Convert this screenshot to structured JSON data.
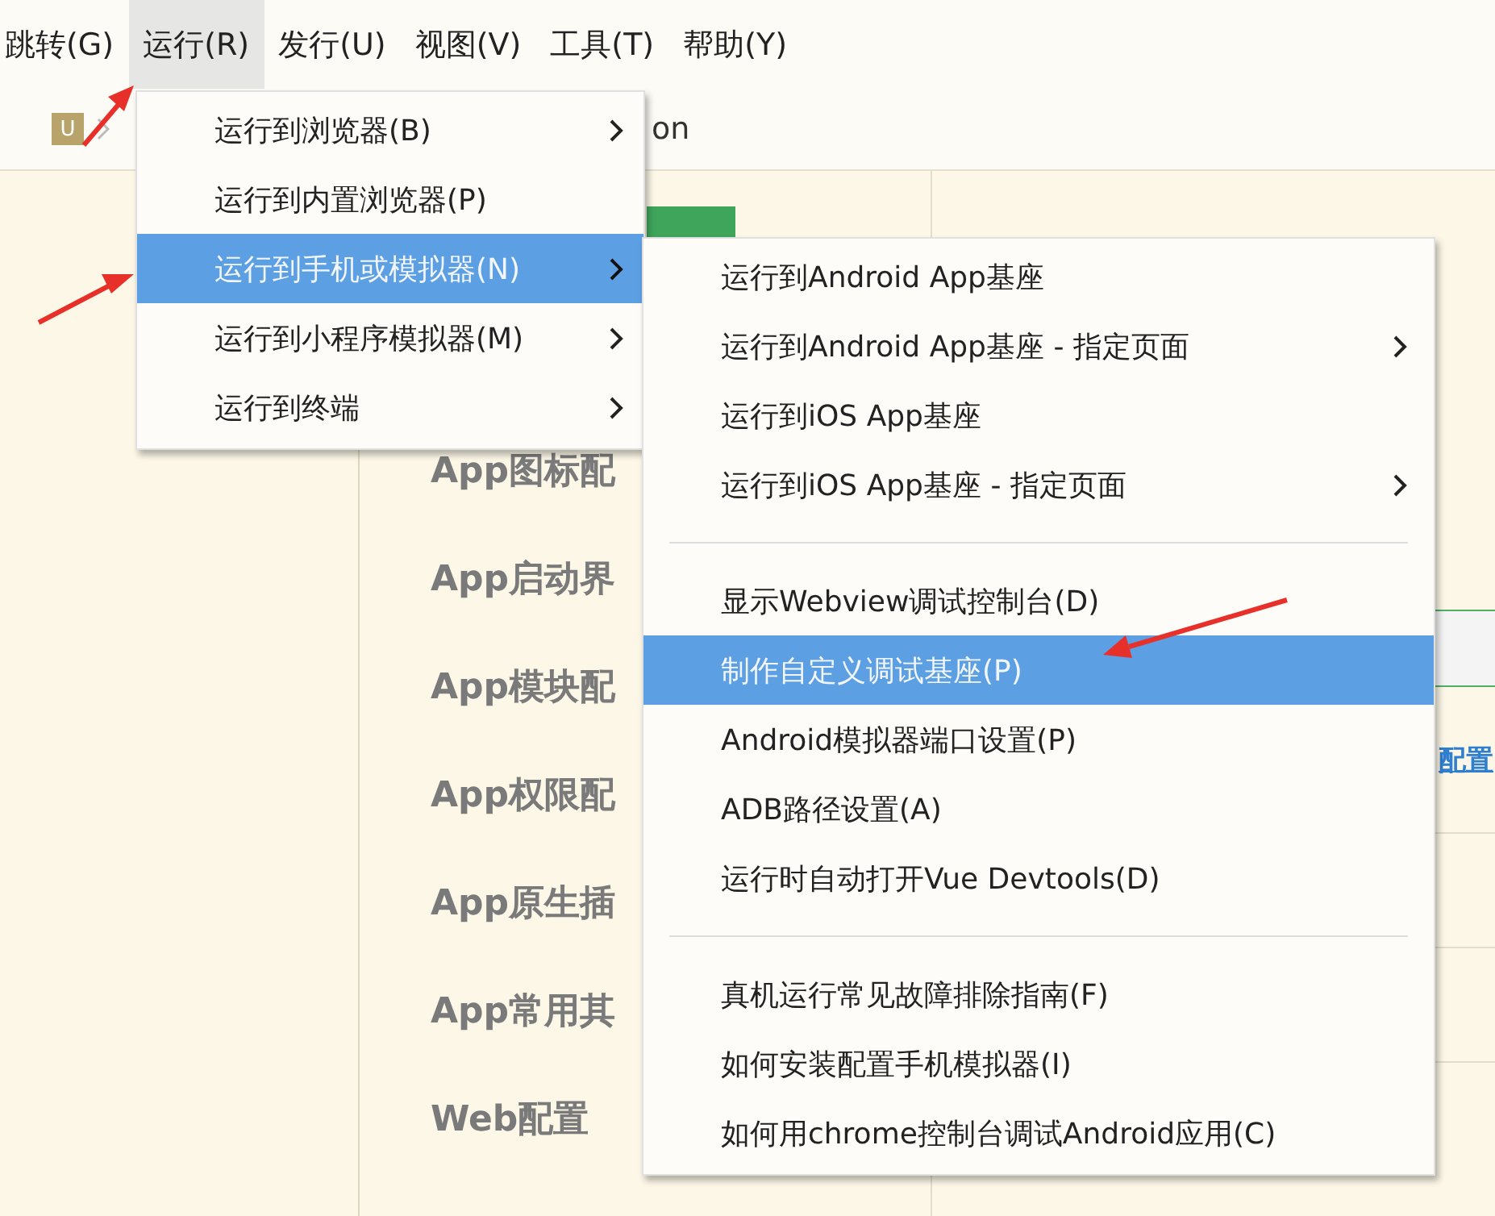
{
  "menu_bar": [
    {
      "label": "跳转(G)",
      "selected": false
    },
    {
      "label": "运行(R)",
      "selected": true
    },
    {
      "label": "发行(U)",
      "selected": false
    },
    {
      "label": "视图(V)",
      "selected": false
    },
    {
      "label": "工具(T)",
      "selected": false
    },
    {
      "label": "帮助(Y)",
      "selected": false
    }
  ],
  "breadcrumb": {
    "project_icon": "U",
    "tail": "on"
  },
  "nav": [
    "App图标配",
    "App启动界",
    "App模块配",
    "App权限配",
    "App原生插",
    "App常用其",
    "Web配置"
  ],
  "link": "配置",
  "run_menu": [
    {
      "label": "运行到浏览器(B)",
      "submenu": true,
      "selected": false
    },
    {
      "label": "运行到内置浏览器(P)",
      "submenu": false,
      "selected": false
    },
    {
      "label": "运行到手机或模拟器(N)",
      "submenu": true,
      "selected": true
    },
    {
      "label": "运行到小程序模拟器(M)",
      "submenu": true,
      "selected": false
    },
    {
      "label": "运行到终端",
      "submenu": true,
      "selected": false
    }
  ],
  "submenu": [
    {
      "kind": "item",
      "label": "运行到Android App基座",
      "submenu": false,
      "selected": false
    },
    {
      "kind": "item",
      "label": "运行到Android App基座 - 指定页面",
      "submenu": true,
      "selected": false
    },
    {
      "kind": "item",
      "label": "运行到iOS App基座",
      "submenu": false,
      "selected": false
    },
    {
      "kind": "item",
      "label": "运行到iOS App基座 - 指定页面",
      "submenu": true,
      "selected": false
    },
    {
      "kind": "separator"
    },
    {
      "kind": "item",
      "label": "显示Webview调试控制台(D)",
      "submenu": false,
      "selected": false
    },
    {
      "kind": "item",
      "label": "制作自定义调试基座(P)",
      "submenu": false,
      "selected": true
    },
    {
      "kind": "item",
      "label": "Android模拟器端口设置(P)",
      "submenu": false,
      "selected": false
    },
    {
      "kind": "item",
      "label": "ADB路径设置(A)",
      "submenu": false,
      "selected": false
    },
    {
      "kind": "item",
      "label": "运行时自动打开Vue Devtools(D)",
      "submenu": false,
      "selected": false
    },
    {
      "kind": "separator"
    },
    {
      "kind": "item",
      "label": "真机运行常见故障排除指南(F)",
      "submenu": false,
      "selected": false
    },
    {
      "kind": "item",
      "label": "如何安装配置手机模拟器(I)",
      "submenu": false,
      "selected": false
    },
    {
      "kind": "item",
      "label": "如何用chrome控制台调试Android应用(C)",
      "submenu": false,
      "selected": false
    }
  ]
}
